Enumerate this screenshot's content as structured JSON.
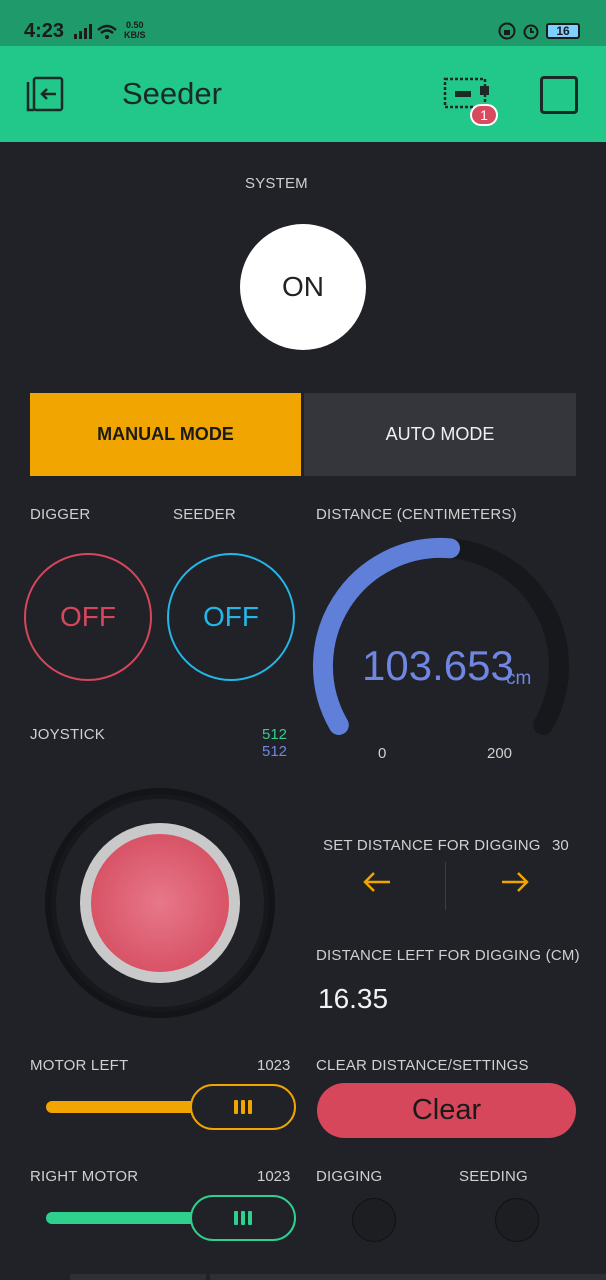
{
  "status_bar": {
    "time": "4:23",
    "speed_value": "0.50",
    "speed_unit": "KB/S",
    "battery": "16"
  },
  "app_bar": {
    "title": "Seeder",
    "notification_count": "1"
  },
  "system": {
    "label": "SYSTEM",
    "button_label": "ON"
  },
  "modes": {
    "manual": "MANUAL MODE",
    "auto": "AUTO MODE",
    "selected": "manual"
  },
  "digger": {
    "label": "DIGGER",
    "state": "OFF",
    "color": "#d6475c"
  },
  "seeder": {
    "label": "SEEDER",
    "state": "OFF",
    "color": "#23b6e6"
  },
  "distance_gauge": {
    "label": "DISTANCE (CENTIMETERS)",
    "value": "103.653",
    "numeric_value": 103.653,
    "unit": "cm",
    "min": "0",
    "max": "200",
    "color": "#5f7fd9"
  },
  "joystick": {
    "label": "JOYSTICK",
    "x": "512",
    "y": "512",
    "x_color": "#2fd08e",
    "y_color": "#6f87e3"
  },
  "set_distance": {
    "label": "SET DISTANCE FOR DIGGING",
    "value": "30",
    "left_icon": "arrow-left-icon",
    "right_icon": "arrow-right-icon"
  },
  "distance_left": {
    "label": "DISTANCE LEFT FOR DIGGING (CM)",
    "value": "16.35"
  },
  "motor_left": {
    "label": "MOTOR LEFT",
    "value": "1023",
    "color": "#f0a500"
  },
  "clear": {
    "label": "CLEAR DISTANCE/SETTINGS",
    "button_label": "Clear"
  },
  "right_motor": {
    "label": "RIGHT MOTOR",
    "value": "1023",
    "color": "#2fd08e"
  },
  "digging": {
    "label": "DIGGING"
  },
  "seeding": {
    "label": "SEEDING"
  }
}
